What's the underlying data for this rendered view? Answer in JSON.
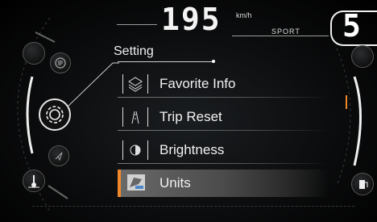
{
  "speed": {
    "value": "195",
    "unit": "km/h",
    "mode": "SPORT"
  },
  "gear": {
    "value": "5"
  },
  "menu": {
    "title": "Setting",
    "items": [
      {
        "label": "Favorite Info",
        "icon": "layers-icon",
        "active": false
      },
      {
        "label": "Trip Reset",
        "icon": "road-icon",
        "active": false
      },
      {
        "label": "Brightness",
        "icon": "brightness-icon",
        "active": false
      },
      {
        "label": "Units",
        "icon": "flag-units-icon",
        "active": true
      }
    ]
  },
  "left_panel": {
    "icons": [
      "phone-list-icon",
      "settings-gear-icon",
      "navigation-arrow-icon",
      "engine-temperature-icon"
    ]
  },
  "right_panel": {
    "icons": [
      "fuel-icon"
    ]
  },
  "colors": {
    "accent": "#f0892b",
    "text": "#f2f2f2",
    "background": "#0b0c0d"
  }
}
